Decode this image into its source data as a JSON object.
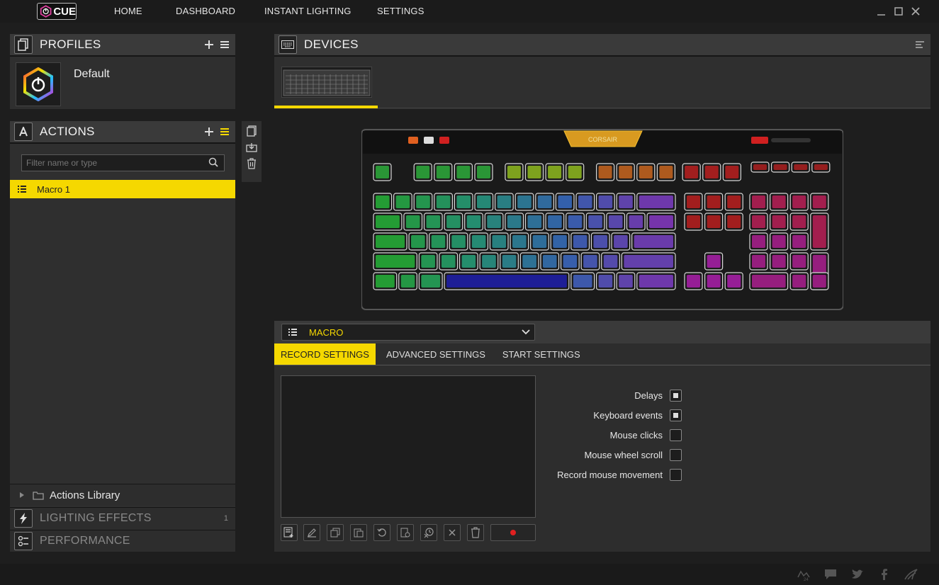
{
  "app": {
    "logo_text": "CUE"
  },
  "nav": {
    "home": "HOME",
    "dashboard": "DASHBOARD",
    "instant_lighting": "INSTANT LIGHTING",
    "settings": "SETTINGS"
  },
  "profiles": {
    "title": "PROFILES",
    "items": [
      {
        "name": "Default"
      }
    ]
  },
  "actions": {
    "title": "ACTIONS",
    "filter_placeholder": "Filter name or type",
    "items": [
      {
        "label": "Macro 1"
      }
    ],
    "library": "Actions Library"
  },
  "sections": {
    "lighting_effects": "LIGHTING EFFECTS",
    "lighting_effects_count": "1",
    "performance": "PERFORMANCE"
  },
  "devices": {
    "title": "DEVICES"
  },
  "macro": {
    "type": "MACRO",
    "tabs": [
      "RECORD SETTINGS",
      "ADVANCED SETTINGS",
      "START SETTINGS"
    ],
    "active_tab": 0,
    "options": [
      {
        "label": "Delays",
        "checked": true
      },
      {
        "label": "Keyboard events",
        "checked": true
      },
      {
        "label": "Mouse clicks",
        "checked": false
      },
      {
        "label": "Mouse wheel scroll",
        "checked": false
      },
      {
        "label": "Record mouse movement",
        "checked": false
      }
    ]
  },
  "colors": {
    "accent": "#f5d800",
    "background": "#1e1e1e",
    "panel": "#2f2f2f"
  }
}
